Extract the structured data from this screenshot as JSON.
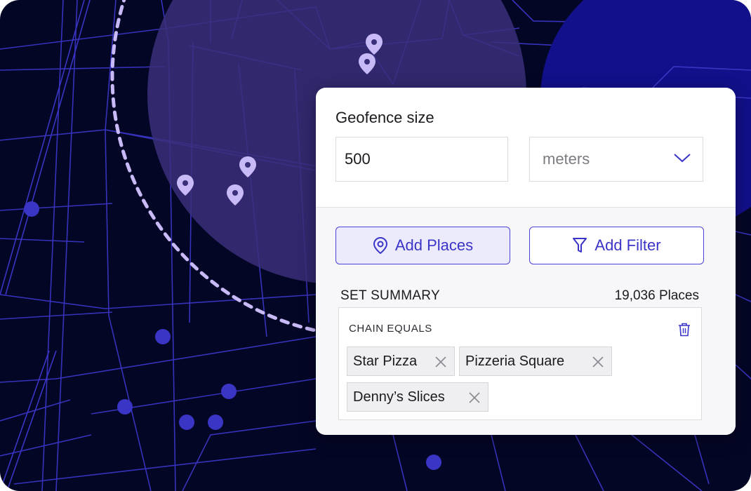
{
  "colors": {
    "map_background": "#040626",
    "map_streets": "#3a35c4",
    "geofence_fill": "#3a2f7a",
    "geofence_ring": "#c8b9f7",
    "accent": "#3b34c8",
    "accent_light_fill": "#ecebfb"
  },
  "icons": [
    "map-pin-icon",
    "location-pin-icon",
    "filter-icon",
    "chevron-down-icon",
    "trash-icon",
    "close-icon"
  ],
  "geofence": {
    "title": "Geofence size",
    "size_value": "500",
    "unit_selected": "meters"
  },
  "actions": {
    "add_places_label": "Add Places",
    "add_filter_label": "Add Filter"
  },
  "summary": {
    "title": "SET SUMMARY",
    "count": "19,036 Places",
    "criteria_label": "CHAIN EQUALS",
    "chips": [
      "Star Pizza",
      "Pizzeria Square",
      "Denny’s Slices"
    ]
  }
}
